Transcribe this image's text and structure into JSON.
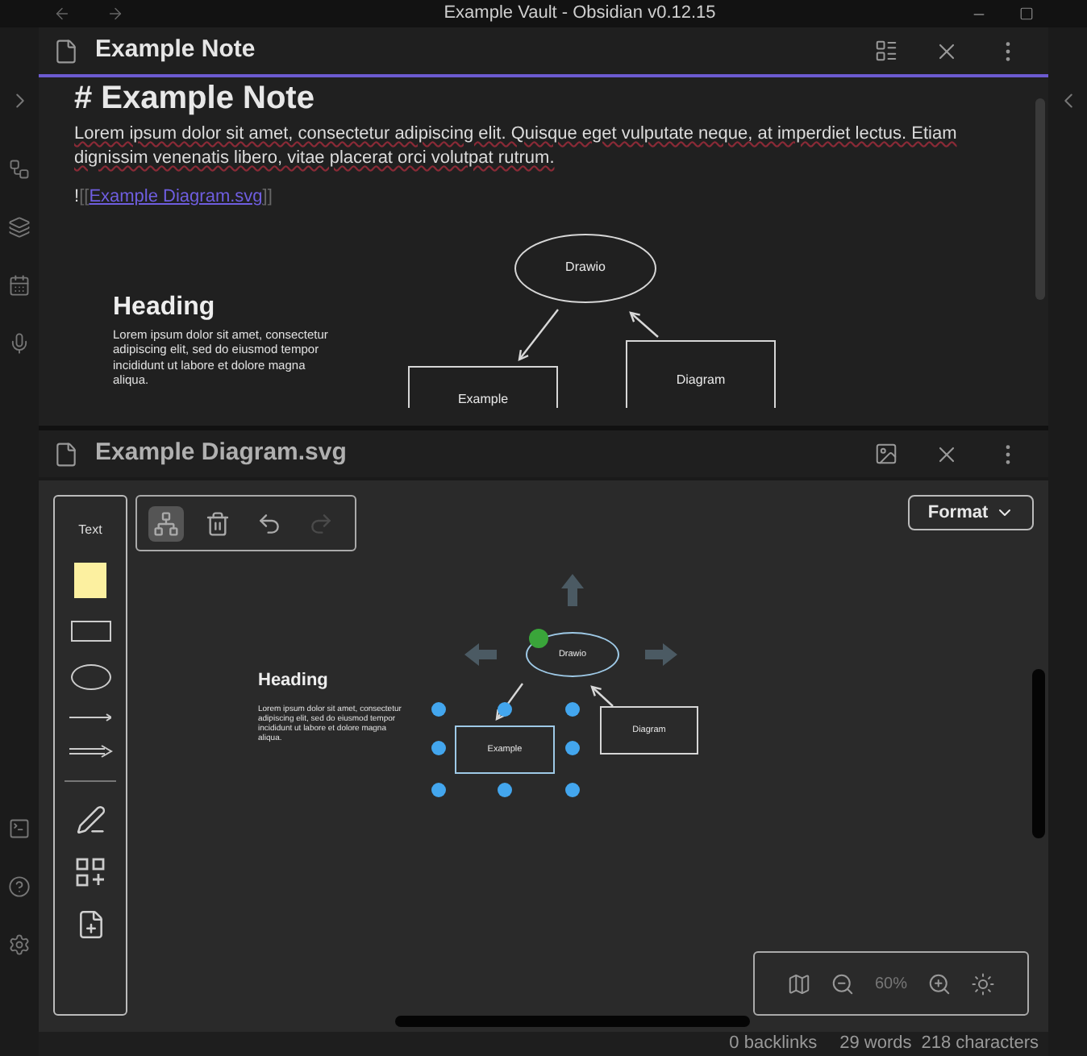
{
  "window": {
    "title": "Example Vault - Obsidian v0.12.15"
  },
  "note_pane": {
    "title": "Example Note",
    "active": true,
    "heading": "# Example Note",
    "paragraph": "Lorem ipsum dolor sit amet, consectetur adipiscing elit. Quisque eget vulputate neque, at imperdiet lectus. Etiam dignissim venenatis libero, vitae placerat orci volutpat rutrum.",
    "embed": {
      "open": "![[",
      "target": "Example Diagram.svg",
      "close": "]]"
    },
    "preview": {
      "heading": "Heading",
      "text": "Lorem ipsum dolor sit amet, consectetur adipiscing elit, sed do eiusmod tempor incididunt ut labore et dolore magna aliqua.",
      "nodes": [
        {
          "kind": "ellipse",
          "label": "Drawio"
        },
        {
          "kind": "rect",
          "label": "Example"
        },
        {
          "kind": "rect",
          "label": "Diagram"
        }
      ]
    }
  },
  "diagram_pane": {
    "title": "Example Diagram.svg",
    "active": false,
    "tools": [
      {
        "kind": "text",
        "label": "Text"
      },
      {
        "kind": "note"
      },
      {
        "kind": "rectangle"
      },
      {
        "kind": "ellipse"
      },
      {
        "kind": "line"
      },
      {
        "kind": "arrow"
      },
      {
        "kind": "divider"
      },
      {
        "kind": "freehand"
      },
      {
        "kind": "shapes"
      },
      {
        "kind": "insert"
      }
    ],
    "actions": [
      {
        "kind": "arrange",
        "active": true,
        "disabled": false
      },
      {
        "kind": "delete",
        "active": false,
        "disabled": false
      },
      {
        "kind": "undo",
        "active": false,
        "disabled": false
      },
      {
        "kind": "redo",
        "active": false,
        "disabled": true
      }
    ],
    "format_button": "Format",
    "zoom": "60%",
    "canvas": {
      "heading": "Heading",
      "text": "Lorem ipsum dolor sit amet, consectetur adipiscing elit, sed do eiusmod tempor incididunt ut labore et dolore magna aliqua.",
      "nodes": [
        {
          "kind": "ellipse",
          "label": "Drawio",
          "selected": true
        },
        {
          "kind": "rect",
          "label": "Example",
          "selected": true
        },
        {
          "kind": "rect",
          "label": "Diagram",
          "selected": false
        }
      ]
    }
  },
  "status_bar": {
    "backlinks": "0 backlinks",
    "words": "29 words",
    "characters": "218 characters"
  }
}
